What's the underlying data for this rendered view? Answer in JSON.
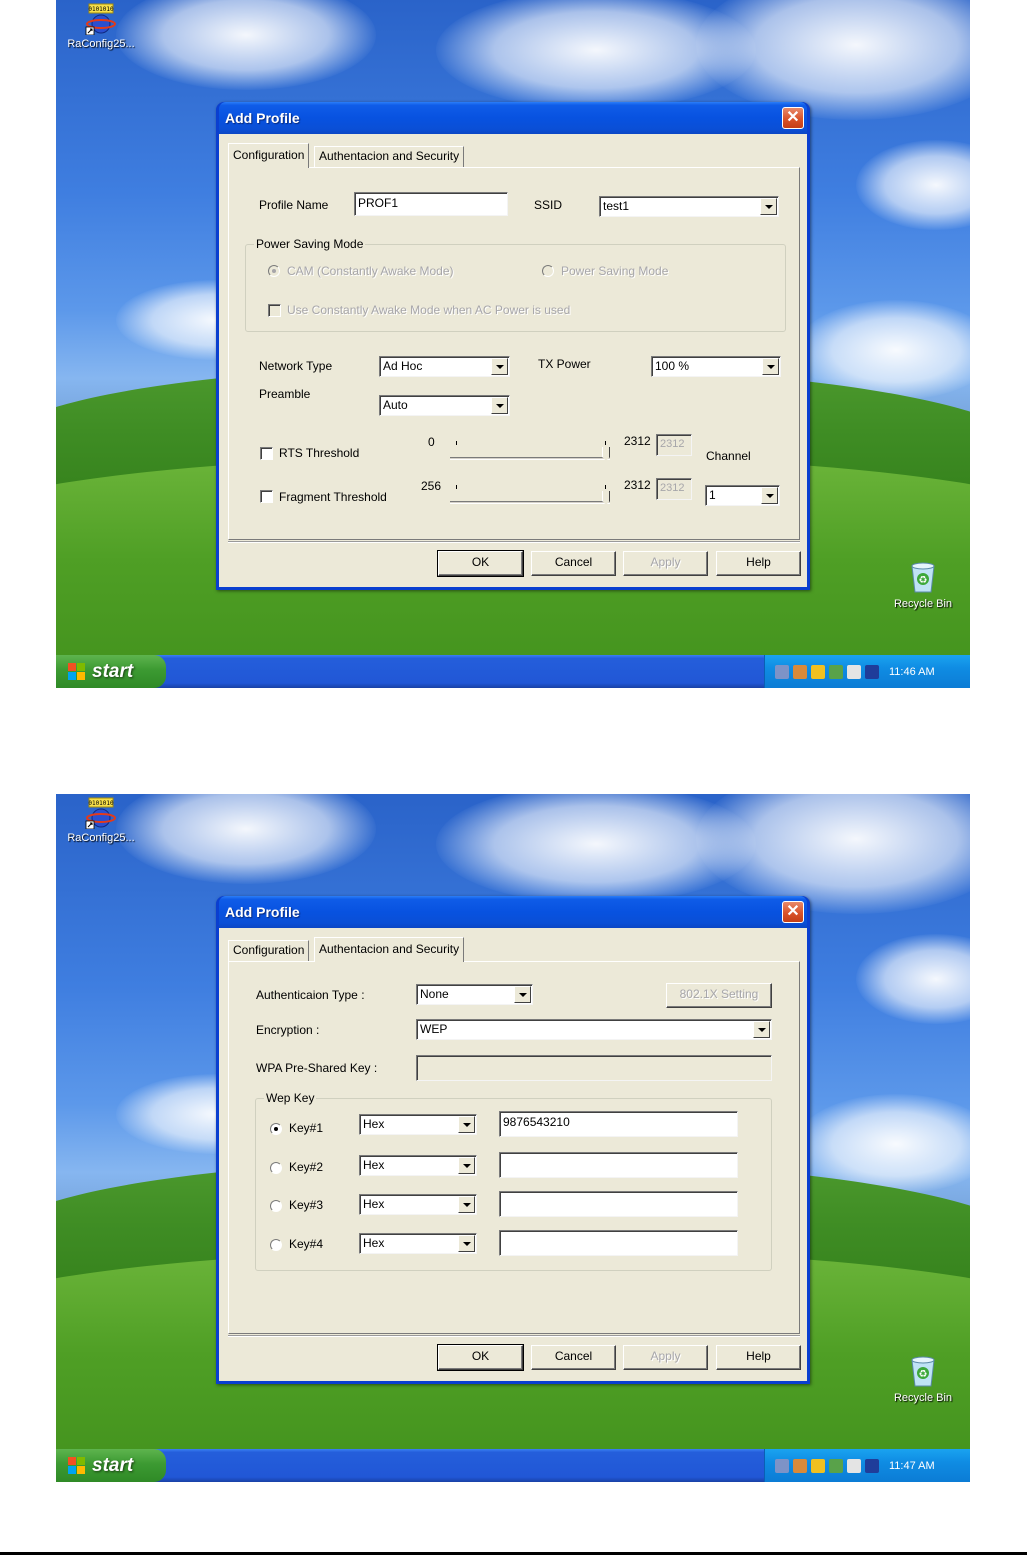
{
  "desktop": {
    "shortcut_label": "RaConfig25...",
    "recycle_label": "Recycle Bin",
    "start_label": "start"
  },
  "screens": [
    {
      "clock": "11:46 AM",
      "dialog_title": "Add Profile",
      "tabs": [
        {
          "label": "Configuration",
          "active": true
        },
        {
          "label": "Authentacion and Security",
          "active": false
        }
      ],
      "config": {
        "profile_name_label": "Profile Name",
        "profile_name_value": "PROF1",
        "ssid_label": "SSID",
        "ssid_value": "test1",
        "power_saving_group": "Power Saving Mode",
        "cam_label": "CAM (Constantly Awake Mode)",
        "psm_label": "Power Saving Mode",
        "use_cam_label": "Use Constantly Awake Mode when AC Power is used",
        "network_type_label": "Network Type",
        "network_type_value": "Ad Hoc",
        "tx_power_label": "TX Power",
        "tx_power_value": "100 %",
        "preamble_label": "Preamble",
        "preamble_value": "Auto",
        "rts_label": "RTS Threshold",
        "rts_min": "0",
        "rts_max": "2312",
        "rts_value": "2312",
        "frag_label": "Fragment Threshold",
        "frag_min": "256",
        "frag_max": "2312",
        "frag_value": "2312",
        "channel_label": "Channel",
        "channel_value": "1"
      },
      "buttons": {
        "ok": "OK",
        "cancel": "Cancel",
        "apply": "Apply",
        "help": "Help"
      }
    },
    {
      "clock": "11:47 AM",
      "dialog_title": "Add Profile",
      "tabs": [
        {
          "label": "Configuration",
          "active": false
        },
        {
          "label": "Authentacion and Security",
          "active": true
        }
      ],
      "auth": {
        "auth_type_label": "Authenticaion Type :",
        "auth_type_value": "None",
        "dot1x_button": "802.1X Setting",
        "encryption_label": "Encryption :",
        "encryption_value": "WEP",
        "wpa_psk_label": "WPA Pre-Shared Key :",
        "wpa_psk_value": "",
        "wep_group": "Wep Key",
        "keys": [
          {
            "label": "Key#1",
            "format": "Hex",
            "value": "9876543210",
            "selected": true
          },
          {
            "label": "Key#2",
            "format": "Hex",
            "value": "",
            "selected": false
          },
          {
            "label": "Key#3",
            "format": "Hex",
            "value": "",
            "selected": false
          },
          {
            "label": "Key#4",
            "format": "Hex",
            "value": "",
            "selected": false
          }
        ]
      },
      "buttons": {
        "ok": "OK",
        "cancel": "Cancel",
        "apply": "Apply",
        "help": "Help"
      }
    }
  ],
  "colors": {
    "titlebar": "#0852e0",
    "dialog_face": "#ece9d8",
    "taskbar": "#245edb",
    "start_button": "#3c9a32",
    "close_button": "#d9532a"
  }
}
